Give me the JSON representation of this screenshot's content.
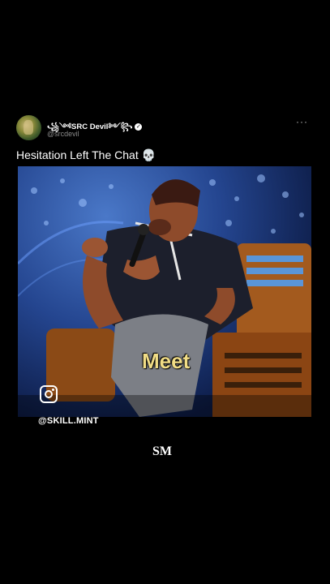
{
  "post": {
    "display_name": "꧁༺SRC Devil༻꧂",
    "handle": "@srcdevil",
    "more_label": "···",
    "text": "Hesitation Left The Chat 💀"
  },
  "video": {
    "caption": "Meet",
    "instagram_handle": "@SKILL.MINT"
  },
  "watermark": "SM",
  "colors": {
    "background": "#000000",
    "caption": "#f1dd86",
    "handle_gray": "#8a8a8a"
  },
  "icons": [
    "avatar",
    "verified-icon",
    "more-options-icon",
    "instagram-icon"
  ]
}
